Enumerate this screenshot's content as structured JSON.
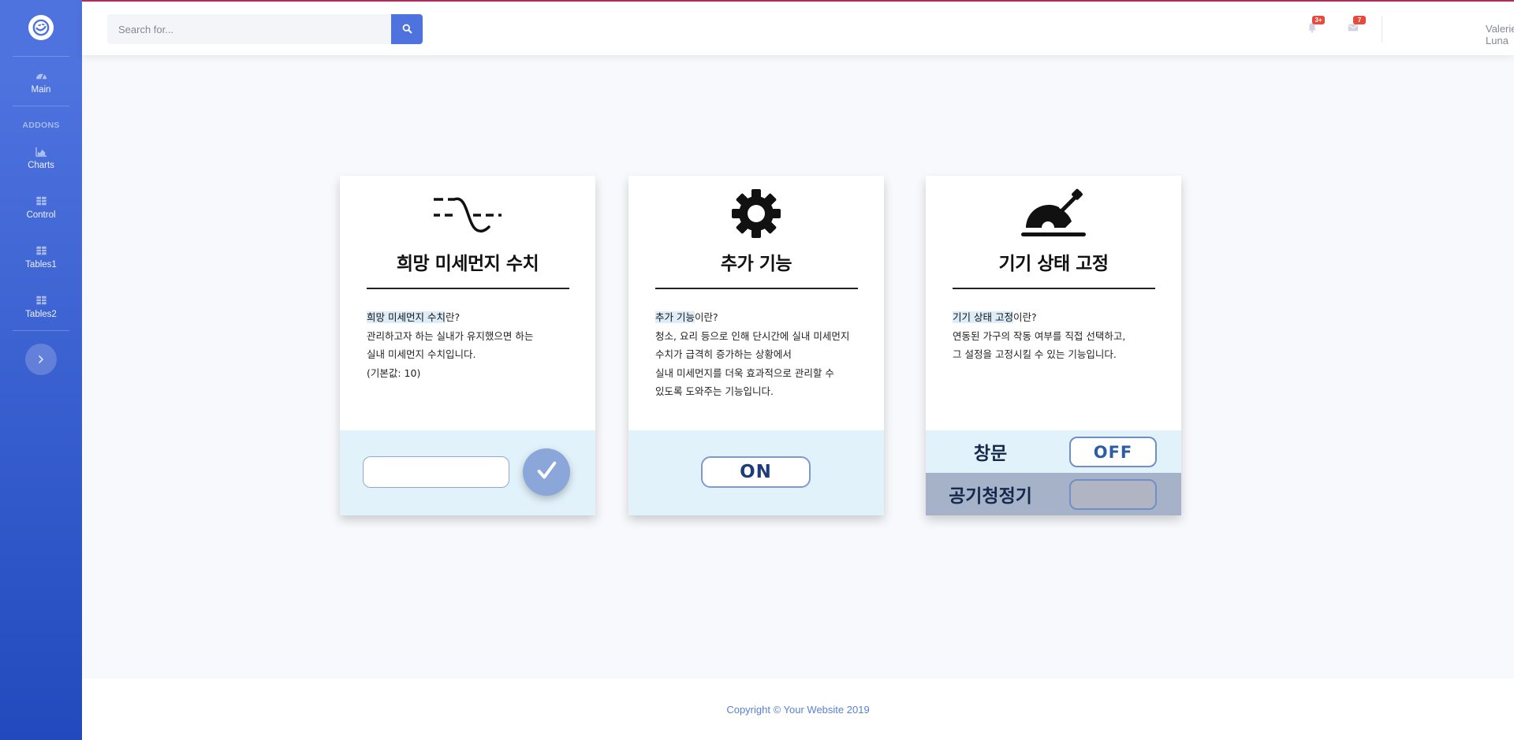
{
  "sidebar": {
    "items": [
      {
        "label": "Main",
        "icon": "tachometer-icon"
      },
      {
        "label": "Charts",
        "icon": "chart-area-icon"
      },
      {
        "label": "Control",
        "icon": "table-icon"
      },
      {
        "label": "Tables1",
        "icon": "table-icon"
      },
      {
        "label": "Tables2",
        "icon": "table-icon"
      }
    ],
    "heading": "ADDONS"
  },
  "topbar": {
    "search_placeholder": "Search for...",
    "alerts_badge": "3+",
    "messages_badge": "7",
    "username": "Valerie Luna"
  },
  "cards": [
    {
      "icon": "wave-icon",
      "title": "희망 미세먼지 수치",
      "desc_highlight": "희망 미세먼지 수치",
      "desc_suffix": "란?",
      "desc_lines": [
        "관리하고자 하는 실내가 유지했으면 하는",
        "실내 미세먼지 수치입니다.",
        "(기본값: 10)"
      ],
      "input_value": ""
    },
    {
      "icon": "gear-icon",
      "title": "추가 기능",
      "desc_highlight": "추가 기능",
      "desc_suffix": "이란?",
      "desc_lines": [
        "청소, 요리 등으로 인해 단시간에 실내 미세먼지",
        "수치가 급격히 증가하는 상황에서",
        "실내 미세먼지를 더욱 효과적으로 관리할 수",
        "있도록 도와주는 기능입니다."
      ],
      "button_label": "ON"
    },
    {
      "icon": "lever-icon",
      "title": "기기 상태 고정",
      "desc_highlight": "기기 상태 고정",
      "desc_suffix": "이란?",
      "desc_lines": [
        "연동된 가구의 작동 여부를 직접 선택하고,",
        "그 설정을 고정시킬 수 있는 기능입니다."
      ],
      "rows": [
        {
          "label": "창문",
          "button_label": "OFF"
        },
        {
          "label": "공기청정기",
          "button_label": ""
        }
      ]
    }
  ],
  "footer": {
    "copyright": "Copyright © Your Website 2019"
  },
  "colors": {
    "primary": "#4e73df",
    "sidebar_end": "#224abe",
    "badge": "#e74a3b",
    "card_bottom": "#e2f2fb"
  }
}
